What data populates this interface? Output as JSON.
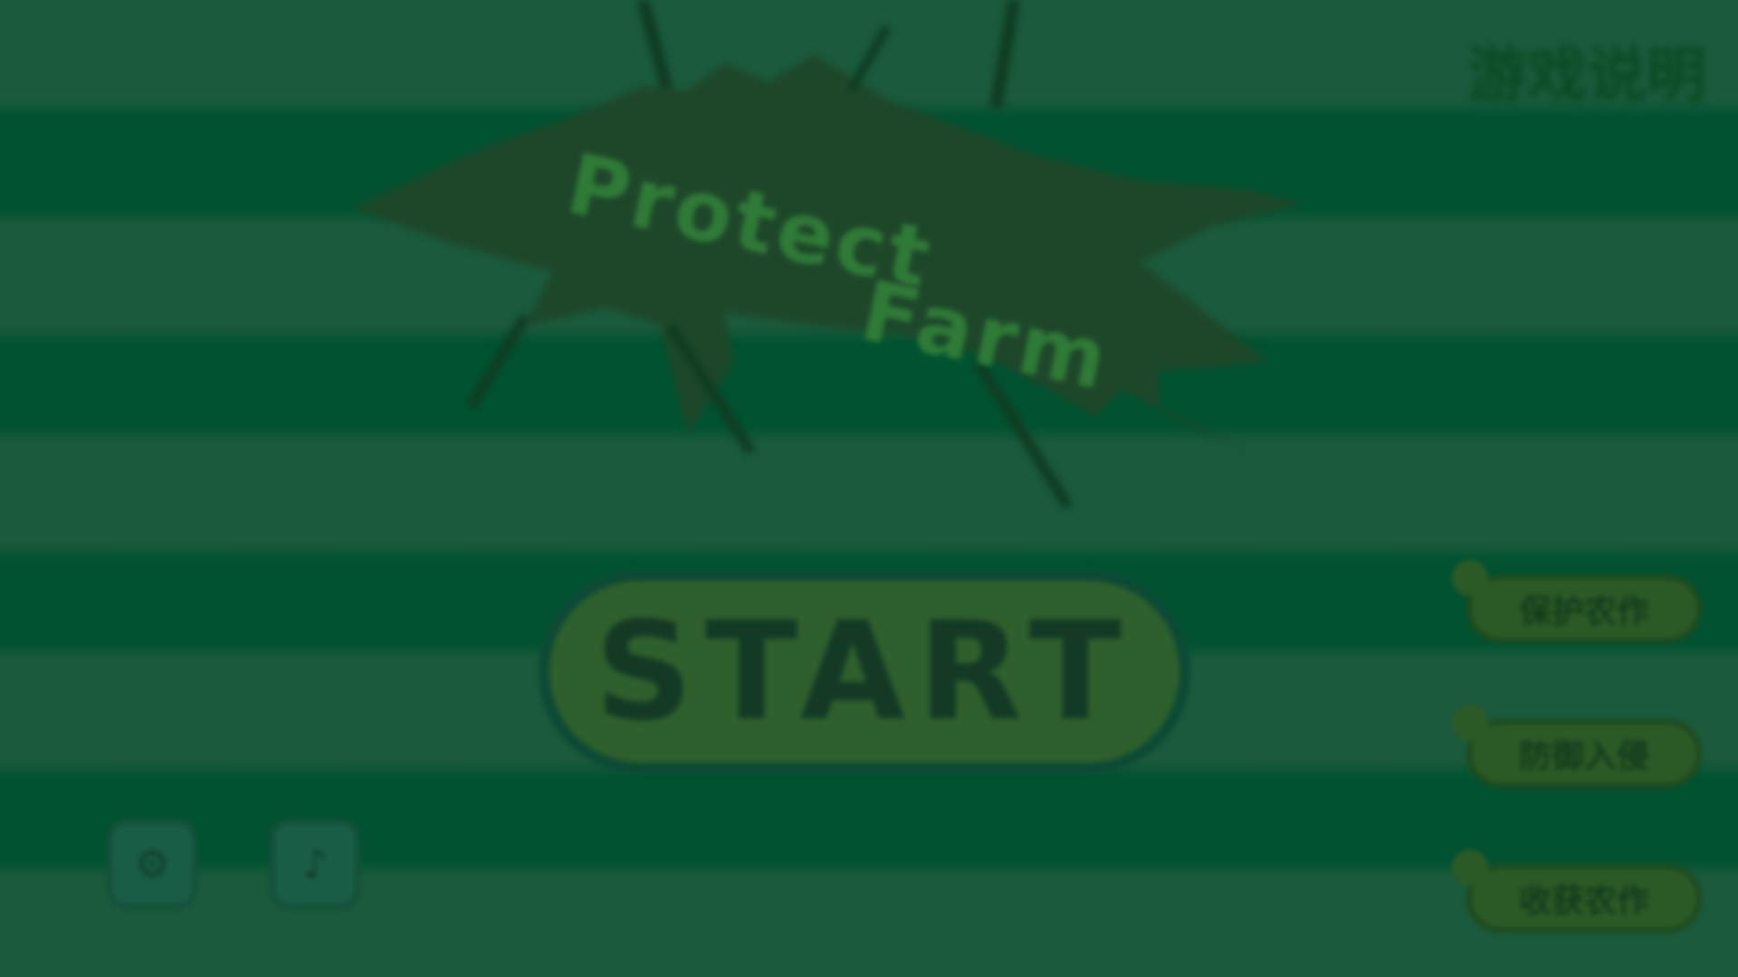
{
  "title": {
    "line1": "Protect",
    "line2": "Farm"
  },
  "top_right_label": "游戏说明",
  "start_button": {
    "label": "START"
  },
  "bottom_icons": {
    "settings_glyph": "⚙",
    "music_glyph": "♪"
  },
  "menu": {
    "items": [
      {
        "label": "保护农作"
      },
      {
        "label": "防御入侵"
      },
      {
        "label": "收获农作"
      }
    ]
  },
  "colors": {
    "background": "#1b5a3c",
    "stripe": "#005231",
    "accent": "#2e5f2c"
  }
}
